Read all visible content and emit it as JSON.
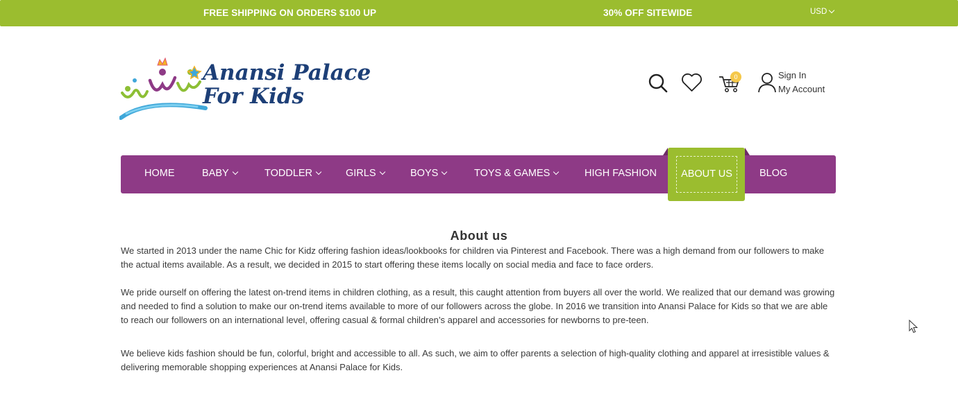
{
  "topbar": {
    "promo_shipping": "FREE SHIPPING ON ORDERS $100 UP",
    "promo_discount": "30% OFF SITEWIDE",
    "currency": "USD",
    "bg_color": "#9bbd2f"
  },
  "logo": {
    "line1": "Anansi Palace",
    "line2": "For Kids"
  },
  "header": {
    "icons": [
      "search-icon",
      "heart-icon",
      "cart-icon",
      "user-icon"
    ],
    "cart_count": "0",
    "sign_in": "Sign In",
    "my_account": "My Account"
  },
  "nav": {
    "bg_color": "#8e3a86",
    "active_color": "#9bbd2f",
    "items": [
      {
        "label": "HOME",
        "dropdown": false
      },
      {
        "label": "BABY",
        "dropdown": true
      },
      {
        "label": "TODDLER",
        "dropdown": true
      },
      {
        "label": "GIRLS",
        "dropdown": true
      },
      {
        "label": "BOYS",
        "dropdown": true
      },
      {
        "label": "TOYS & GAMES",
        "dropdown": true
      },
      {
        "label": "HIGH FASHION",
        "dropdown": false
      },
      {
        "label": "ABOUT US",
        "dropdown": false,
        "active": true
      },
      {
        "label": "BLOG",
        "dropdown": false
      }
    ]
  },
  "content": {
    "title": "About us",
    "paragraphs": [
      "We started in 2013 under the name Chic for Kidz offering fashion ideas/lookbooks for children via Pinterest and Facebook. There was a high demand from our followers to make the actual items available. As a result, we decided in 2015 to start offering these items locally on social media and face to face orders.",
      "We pride ourself on offering the latest on-trend items in children clothing, as a result, this caught attention from buyers all over the world. We realized that our demand was growing and needed to find a solution to make our on-trend items available to more of our followers across the globe. In 2016 we transition into Anansi Palace for Kids so that we are able to reach our followers on an international level, offering casual & formal children’s apparel and accessories for newborns to pre-teen.",
      "We believe kids fashion should be fun, colorful, bright and accessible to all. As such, we aim to offer parents a selection of high-quality clothing and apparel at irresistible values & delivering memorable shopping experiences at Anansi Palace for Kids."
    ]
  }
}
